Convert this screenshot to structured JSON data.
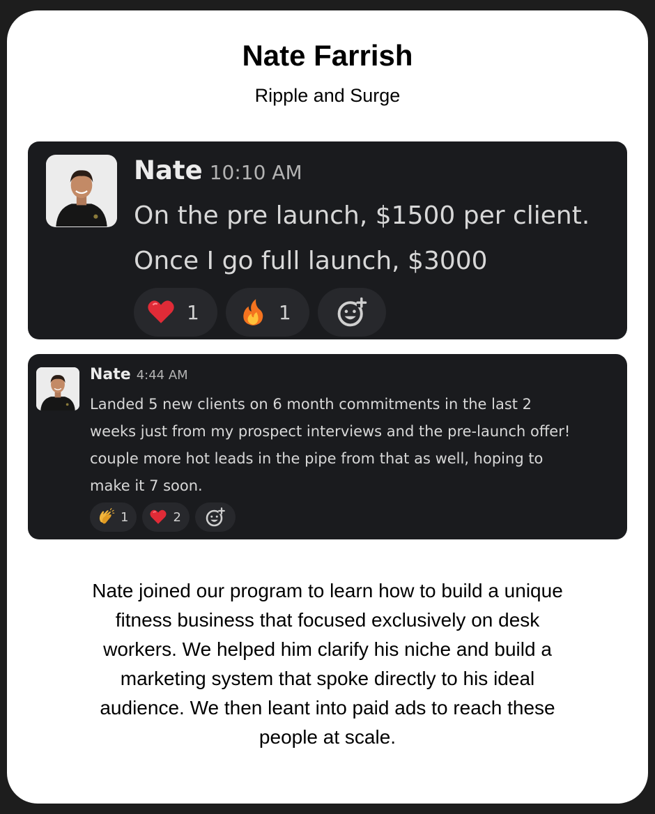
{
  "header": {
    "title": "Nate Farrish",
    "subtitle": "Ripple and Surge"
  },
  "messages": [
    {
      "author": "Nate",
      "time": "10:10 AM",
      "lines": [
        "On the pre launch, $1500 per client.",
        "Once I go full launch, $3000"
      ],
      "reactions": [
        {
          "emoji": "heart-icon",
          "count": "1"
        },
        {
          "emoji": "fire-icon",
          "count": "1"
        }
      ]
    },
    {
      "author": "Nate",
      "time": "4:44 AM",
      "lines": [
        "Landed 5 new clients on 6 month commitments in the last 2",
        "weeks just from my prospect interviews and the pre-launch offer!",
        "couple more hot leads in the pipe from that as well, hoping to",
        "make it 7 soon."
      ],
      "reactions": [
        {
          "emoji": "clapping-hands-icon",
          "count": "1"
        },
        {
          "emoji": "heart-icon",
          "count": "2"
        }
      ]
    }
  ],
  "description": {
    "lines": [
      "Nate joined our program to learn how to build a unique",
      "fitness business that focused exclusively on desk",
      "workers. We helped him clarify his niche and build a",
      "marketing system that spoke directly to his ideal",
      "audience. We then leant into paid ads to reach these",
      "people at scale."
    ]
  },
  "colors": {
    "page_background": "#1d1d1d",
    "card_background": "#ffffff",
    "message_background": "#1a1b1e",
    "reaction_background": "#27282c"
  }
}
